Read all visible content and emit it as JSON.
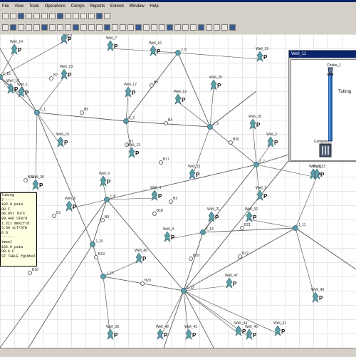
{
  "menu": [
    "File",
    "View",
    "Tools",
    "Operations",
    "Comps",
    "Reports",
    "Extend",
    "Window",
    "Help"
  ],
  "canvas": {
    "nodes": [
      {
        "id": "B7",
        "label": "B7"
      },
      {
        "id": "B6",
        "label": "B6"
      },
      {
        "id": "B5",
        "label": "B5"
      },
      {
        "id": "B2",
        "label": "B2"
      },
      {
        "id": "B3",
        "label": "B3"
      },
      {
        "id": "B9",
        "label": "B9"
      },
      {
        "id": "B4",
        "label": "B4"
      },
      {
        "id": "B17",
        "label": "B17"
      },
      {
        "id": "B13",
        "label": "B13"
      },
      {
        "id": "D1",
        "label": "D1"
      },
      {
        "id": "B18",
        "label": "B18"
      },
      {
        "id": "B19",
        "label": "B19"
      },
      {
        "id": "B21",
        "label": "B21"
      },
      {
        "id": "B22",
        "label": "B22"
      },
      {
        "id": "B20",
        "label": "B20"
      },
      {
        "id": "B10",
        "label": "B10"
      },
      {
        "id": "B11",
        "label": "B11"
      },
      {
        "id": "B26",
        "label": "B26"
      },
      {
        "id": "B12",
        "label": "B12"
      }
    ],
    "junctions": [
      {
        "id": "J_1",
        "label": "J_1"
      },
      {
        "id": "J_2",
        "label": "J_2"
      },
      {
        "id": "J_3",
        "label": "J_3"
      },
      {
        "id": "J_6",
        "label": "J_6"
      },
      {
        "id": "J_7",
        "label": "J_7"
      },
      {
        "id": "J_9",
        "label": "J_9"
      },
      {
        "id": "J_10",
        "label": "J_10"
      },
      {
        "id": "J_11",
        "label": "J_11"
      },
      {
        "id": "J_12",
        "label": "J_12"
      },
      {
        "id": "J_13",
        "label": "J_13"
      },
      {
        "id": "J_14",
        "label": "J_14"
      },
      {
        "id": "J_15",
        "label": "J_15"
      }
    ],
    "wells": [
      {
        "label": "Well_14"
      },
      {
        "label": "Well_23"
      },
      {
        "label": "Well_17"
      },
      {
        "label": "Well_20"
      },
      {
        "label": "Well_12"
      },
      {
        "label": "Well_18"
      },
      {
        "label": "Well_13"
      },
      {
        "label": "Well_15"
      },
      {
        "label": "Well_1"
      },
      {
        "label": "Well_19"
      },
      {
        "label": "Well_16"
      },
      {
        "label": "Well_2"
      },
      {
        "label": "Well_11"
      },
      {
        "label": "Well_8"
      },
      {
        "label": "Well_6"
      },
      {
        "label": "Well_4"
      },
      {
        "label": "Well_3"
      },
      {
        "label": "Well_21"
      },
      {
        "label": "Well_9"
      },
      {
        "label": "Well_32"
      },
      {
        "label": "Well_31"
      },
      {
        "label": "Well_33"
      },
      {
        "label": "Well_30"
      },
      {
        "label": "Well_46"
      },
      {
        "label": "Well_47"
      },
      {
        "label": "Well_40"
      },
      {
        "label": "Well_36"
      },
      {
        "label": "Well_42"
      },
      {
        "label": "Well_43"
      },
      {
        "label": "Well_44"
      },
      {
        "label": "Well_41"
      },
      {
        "label": "Well_45"
      },
      {
        "label": "Well_10"
      },
      {
        "label": "Well_5"
      },
      {
        "label": "Well_7"
      }
    ],
    "p_label": "P"
  },
  "tooltip": {
    "lines": [
      "Tubing",
      "7 ----",
      "102.0 psia",
      "00 F",
      "96.957 lb/s",
      "89.496 STB/d",
      "1.211 mmscf/d",
      "5.50 scf/STB",
      "6 %",
      "------",
      "tmsel",
      "102.0 psia",
      "09.6 F",
      "ST TABLE fgibbal"
    ]
  },
  "popup": {
    "title": "Well_11",
    "choke_label": "Choke_1",
    "tubing_label": "Tubing",
    "completion_label": "Completion"
  },
  "colors": {
    "well": "#5f9fa8",
    "line": "#4a4a4a",
    "node": "#ffffff",
    "popup_title": "#0a246a",
    "tubing": "#1f5fa8"
  }
}
